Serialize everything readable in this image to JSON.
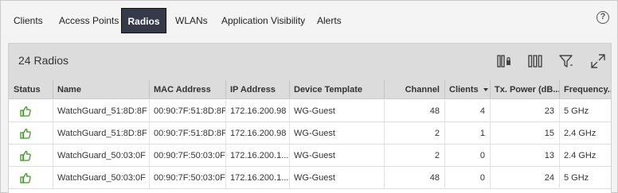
{
  "tabs": [
    {
      "label": "Clients"
    },
    {
      "label": "Access Points"
    },
    {
      "label": "Radios",
      "active": true
    },
    {
      "label": "WLANs"
    },
    {
      "label": "Application Visibility"
    },
    {
      "label": "Alerts"
    }
  ],
  "help_icon": "?",
  "panel": {
    "title": "24 Radios",
    "tools": [
      "column-chooser-icon",
      "columns-icon",
      "filter-icon",
      "expand-icon"
    ]
  },
  "table": {
    "columns": [
      "Status",
      "Name",
      "MAC Address",
      "IP Address",
      "Device Template",
      "Channel",
      "Clients",
      "Tx. Power (dB...",
      "Frequency..."
    ],
    "sorted_column": "Clients",
    "rows": [
      {
        "status": "thumbs-up-icon",
        "name": "WatchGuard_51:8D:8F",
        "mac": "00:90:7F:51:8D:8F",
        "ip": "172.16.200.98",
        "template": "WG-Guest",
        "channel": "48",
        "clients": "4",
        "tx_power": "23",
        "frequency": "5 GHz"
      },
      {
        "status": "thumbs-up-icon",
        "name": "WatchGuard_51:8D:8F",
        "mac": "00:90:7F:51:8D:8F",
        "ip": "172.16.200.98",
        "template": "WG-Guest",
        "channel": "2",
        "clients": "1",
        "tx_power": "15",
        "frequency": "2.4 GHz"
      },
      {
        "status": "thumbs-up-icon",
        "name": "WatchGuard_50:03:0F",
        "mac": "00:90:7F:50:03:0F",
        "ip": "172.16.200.1...",
        "template": "WG-Guest",
        "channel": "2",
        "clients": "0",
        "tx_power": "13",
        "frequency": "2.4 GHz"
      },
      {
        "status": "thumbs-up-icon",
        "name": "WatchGuard_50:03:0F",
        "mac": "00:90:7F:50:03:0F",
        "ip": "172.16.200.1...",
        "template": "WG-Guest",
        "channel": "48",
        "clients": "0",
        "tx_power": "24",
        "frequency": "5 GHz"
      }
    ]
  },
  "colors": {
    "active_tab": "#36394a",
    "status_ok": "#3c9a1c",
    "header_bg": "#dcdcdc"
  }
}
